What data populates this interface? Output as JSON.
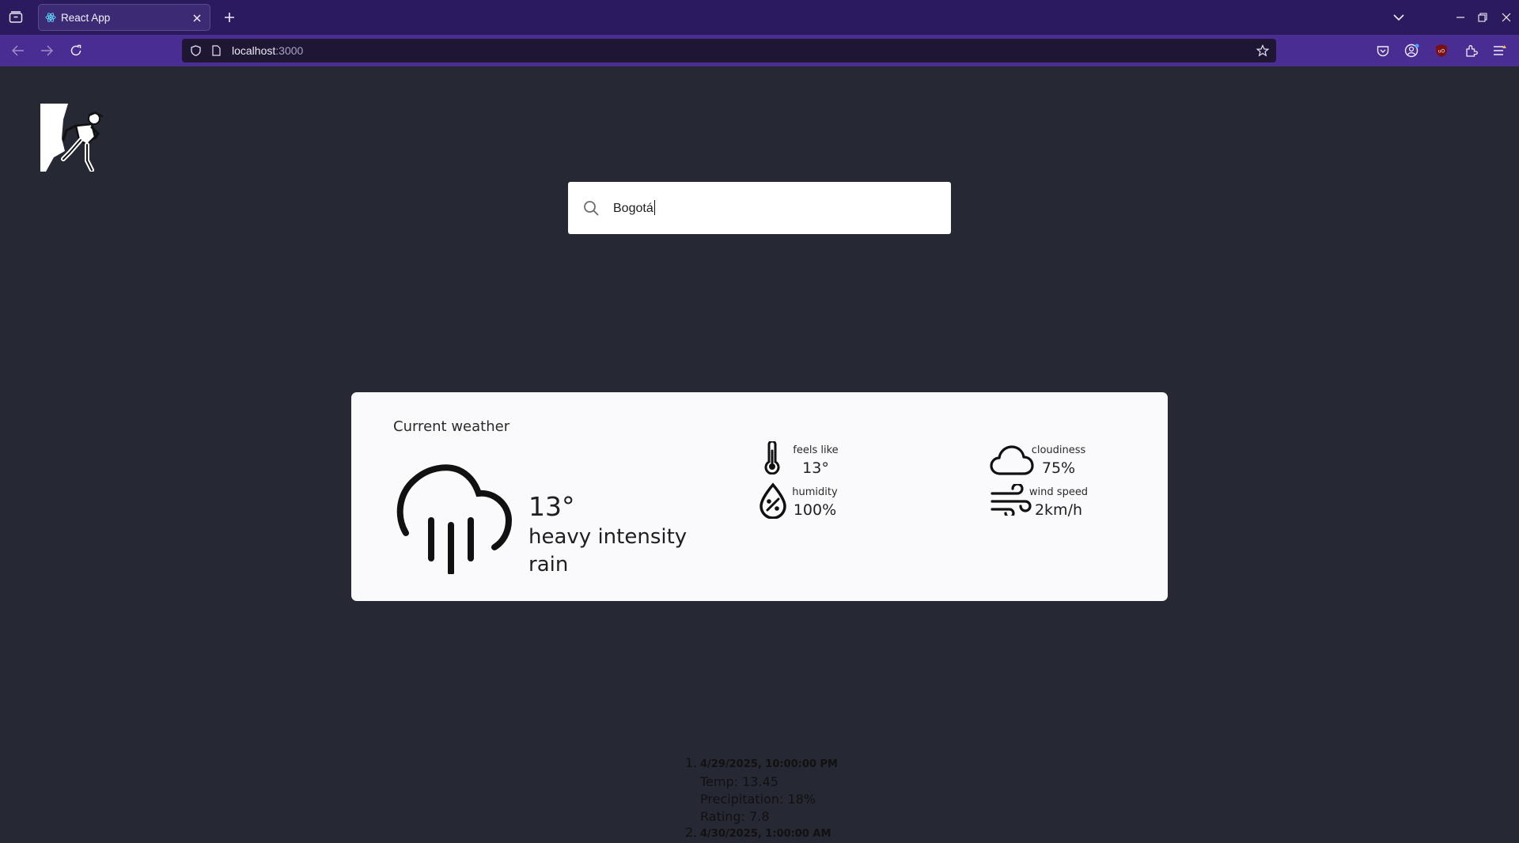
{
  "browser": {
    "tab_title": "React App",
    "url_host": "localhost",
    "url_port": ":3000"
  },
  "search": {
    "value": "Bogotá"
  },
  "current_weather": {
    "title": "Current weather",
    "temperature": "13°",
    "description": "heavy intensity rain",
    "icon": "rain-cloud-icon",
    "metrics": {
      "feels_like": {
        "label": "feels like",
        "value": "13°",
        "icon": "thermometer-icon"
      },
      "humidity": {
        "label": "humidity",
        "value": "100%",
        "icon": "humidity-drop-icon"
      },
      "cloudiness": {
        "label": "cloudiness",
        "value": "75%",
        "icon": "cloud-icon"
      },
      "wind_speed": {
        "label": "wind speed",
        "value": "2km/h",
        "icon": "wind-icon"
      }
    }
  },
  "forecast": [
    {
      "number": "1.",
      "date": "4/29/2025, 10:00:00 PM",
      "temp": "Temp: 13.45",
      "precipitation": "Precipitation: 18%",
      "rating": "Rating: 7.8"
    },
    {
      "number": "2.",
      "date": "4/30/2025, 1:00:00 AM"
    }
  ]
}
